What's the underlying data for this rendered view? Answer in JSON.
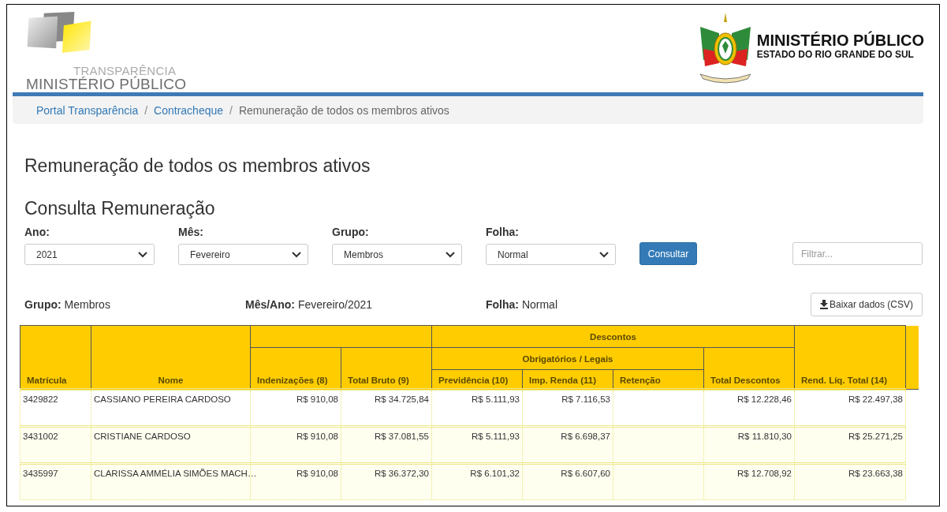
{
  "header": {
    "logo_top": "TRANSPARÊNCIA",
    "logo_bottom": "MINISTÉRIO PÚBLICO",
    "org_title": "MINISTÉRIO PÚBLICO",
    "org_subtitle": "ESTADO DO RIO GRANDE DO SUL"
  },
  "breadcrumb": [
    {
      "kind": "link",
      "label": "Portal Transparência"
    },
    {
      "kind": "separator",
      "label": "/"
    },
    {
      "kind": "link",
      "label": "Contracheque"
    },
    {
      "kind": "separator",
      "label": "/"
    },
    {
      "kind": "current",
      "label": "Remuneração de todos os membros ativos"
    }
  ],
  "page_title": "Remuneração de todos os membros ativos",
  "section_title": "Consulta Remuneração",
  "filters": [
    {
      "label": "Ano:",
      "value": "2021"
    },
    {
      "label": "Mês:",
      "value": "Fevereiro"
    },
    {
      "label": "Grupo:",
      "value": "Membros"
    },
    {
      "label": "Folha:",
      "value": "Normal"
    }
  ],
  "consult_button": "Consultar",
  "search": {
    "placeholder": "Filtrar..."
  },
  "summary": [
    {
      "label": "Grupo:",
      "value": "Membros"
    },
    {
      "label": "Mês/Ano:",
      "value": "Fevereiro/2021"
    },
    {
      "label": "Folha:",
      "value": "Normal"
    }
  ],
  "download_button": "Baixar dados (CSV)",
  "table": {
    "group": "Descontos",
    "subgroup": "Obrigatórios / Legais",
    "columns": [
      "Matrícula",
      "Nome",
      "Indenizações (8)",
      "Total Bruto (9)",
      "Previdência (10)",
      "Imp. Renda (11)",
      "Retenção",
      "Total Descontos",
      "Rend. Líq. Total (14)"
    ],
    "rows": [
      {
        "highlighted": false,
        "cells": [
          "3429822",
          "CASSIANO PEREIRA CARDOSO",
          "R$  910,08",
          "R$  34.725,84",
          "R$  5.111,93",
          "R$  7.116,53",
          null,
          "R$  12.228,46",
          "R$  22.497,38"
        ]
      },
      {
        "highlighted": true,
        "cells": [
          "3431002",
          "CRISTIANE CARDOSO",
          "R$  910,08",
          "R$  37.081,55",
          "R$  5.111,93",
          "R$  6.698,37",
          null,
          "R$  11.810,30",
          "R$  25.271,25"
        ]
      },
      {
        "highlighted": true,
        "cells": [
          "3435997",
          "CLARISSA AMMÉLIA SIMÕES MACH…",
          "R$  910,08",
          "R$  36.372,30",
          "R$  6.101,32",
          "R$  6.607,60",
          null,
          "R$  12.708,92",
          "R$  23.663,38"
        ]
      }
    ]
  }
}
